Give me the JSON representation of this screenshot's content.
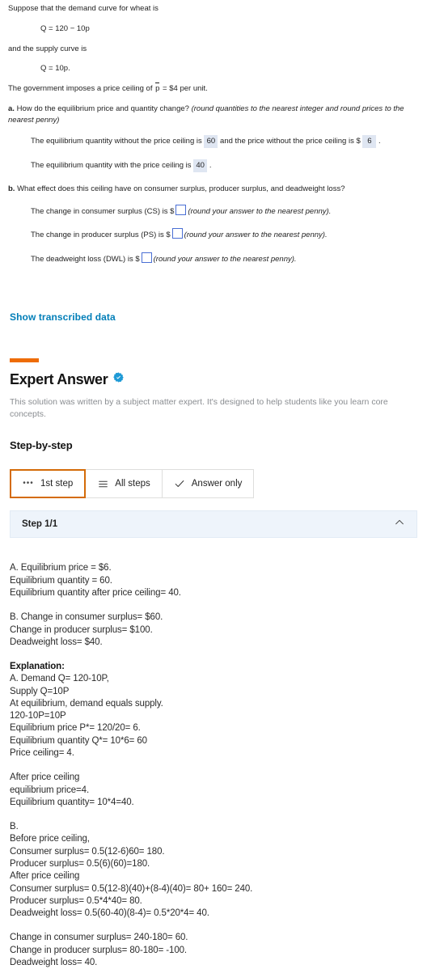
{
  "question": {
    "intro": "Suppose that the demand curve for wheat is",
    "demand_equation": "Q = 120 − 10p",
    "supply_intro": "and the supply curve is",
    "supply_equation": "Q = 10p.",
    "ceiling_pre": "The government imposes a  price ceiling of ",
    "ceiling_symbol": "p",
    "ceiling_post": " = $4 per unit.",
    "part_a_label": "a.",
    "part_a_text": " How do the equilibrium price and quantity change?  ",
    "part_a_hint": "(round quantities to the nearest integer and round prices to the nearest penny)",
    "a1_pre": "The equilibrium quantity without the price ceiling is ",
    "a1_value": "60",
    "a1_mid": " and the price without the price ceiling is $ ",
    "a1_value2": "6",
    "a1_post": " .",
    "a2_pre": "The equilibrium quantity with the price ceiling is ",
    "a2_value": "40",
    "a2_post": " .",
    "part_b_label": "b.",
    "part_b_text": " What effect does this ceiling have on consumer surplus, producer surplus, and deadweight loss?",
    "b1_pre": "The change in consumer surplus (CS) is $",
    "b1_hint": "(round your answer to the nearest penny).",
    "b2_pre": "The change in producer surplus (PS) is $",
    "b2_hint": "(round your answer to the nearest penny).",
    "b3_pre": "The deadweight loss (DWL) is $",
    "b3_hint": "(round your answer to the nearest penny)."
  },
  "transcribed": {
    "link_label": "Show transcribed data"
  },
  "expert": {
    "title": "Expert Answer",
    "badge_icon": "verified-check-icon",
    "description": "This solution was written by a subject matter expert. It's designed to help students like you learn core concepts.",
    "step_by_step_label": "Step-by-step",
    "accent_color": "#ee6c06",
    "tabs": [
      {
        "label": "1st step",
        "icon": "ellipsis-icon",
        "active": true
      },
      {
        "label": "All steps",
        "icon": "hamburger-icon",
        "active": false
      },
      {
        "label": "Answer only",
        "icon": "check-icon",
        "active": false
      }
    ],
    "step_header": {
      "label": "Step 1/1",
      "toggle_icon": "chevron-up-icon"
    }
  },
  "solution": {
    "blocks": [
      {
        "lines": [
          "A. Equilibrium price = $6.",
          "Equilibrium quantity = 60.",
          "Equilibrium quantity after price ceiling= 40."
        ]
      },
      {
        "lines": [
          "B. Change in consumer surplus= $60.",
          "Change in producer surplus= $100.",
          "Deadweight loss= $40."
        ]
      },
      {
        "lines": [
          "Explanation:",
          "A. Demand Q= 120-10P,",
          "Supply Q=10P",
          "At equilibrium, demand equals supply.",
          "120-10P=10P",
          "Equilibrium price P*= 120/20= 6.",
          "Equilibrium quantity Q*= 10*6= 60",
          "Price ceiling= 4."
        ],
        "bold_first": true
      },
      {
        "lines": [
          "After price ceiling",
          "equilibrium price=4.",
          "Equilibrium quantity= 10*4=40."
        ]
      },
      {
        "lines": [
          "B.",
          "Before price ceiling,",
          "Consumer surplus= 0.5(12-6)60= 180.",
          "Producer surplus= 0.5(6)(60)=180.",
          "After price ceiling",
          "Consumer surplus= 0.5(12-8)(40)+(8-4)(40)= 80+ 160= 240.",
          "Producer surplus= 0.5*4*40= 80.",
          "Deadweight loss= 0.5(60-40)(8-4)= 0.5*20*4= 40."
        ]
      },
      {
        "lines": [
          "Change in consumer surplus= 240-180= 60.",
          "Change in producer surplus= 80-180= -100.",
          "Deadweight loss= 40."
        ]
      }
    ]
  }
}
